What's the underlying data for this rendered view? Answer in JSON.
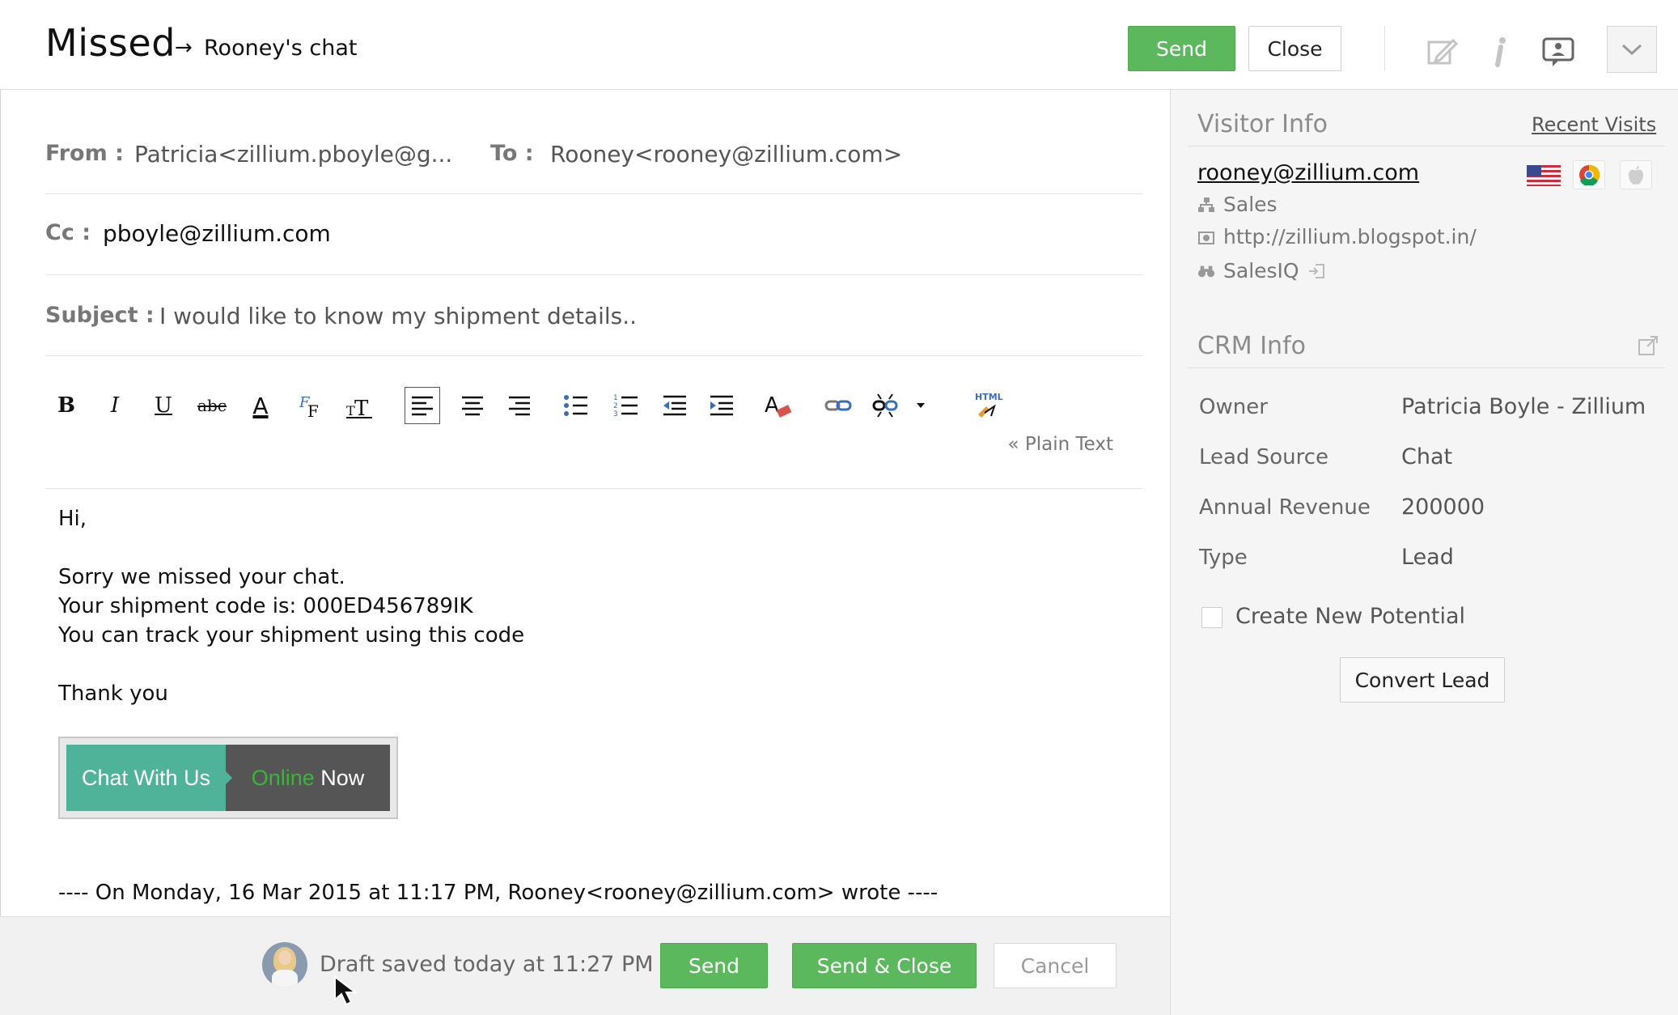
{
  "header": {
    "title": "Missed",
    "arrow": "→",
    "subtitle": "Rooney's chat",
    "send_label": "Send",
    "close_label": "Close"
  },
  "email": {
    "from_label": "From :",
    "from_value": "Patricia<zillium.pboyle@g...",
    "to_label": "To :",
    "to_value": "Rooney<rooney@zillium.com>",
    "cc_label": "Cc :",
    "cc_value": "pboyle@zillium.com",
    "subject_label": "Subject :",
    "subject_value": "I would like to know my shipment details..",
    "plain_text_link": "« Plain Text",
    "body_lines": [
      "Hi,",
      "Sorry we missed your chat.",
      "Your shipment code is: 000ED456789IK",
      "You can track your shipment using this code",
      "Thank you"
    ],
    "banner": {
      "left": "Chat With Us",
      "online": "Online",
      "now": " Now"
    },
    "quote_line": "---- On Monday, 16 Mar 2015 at 11:17 PM, Rooney<rooney@zillium.com> wrote ----"
  },
  "toolbar": {
    "bold": "B",
    "italic": "I",
    "underline": "U",
    "strike": "abc",
    "font_color": "A",
    "html": "HTML"
  },
  "footer": {
    "draft_status": "Draft saved today at 11:27 PM",
    "send_label": "Send",
    "send_close_label": "Send & Close",
    "cancel_label": "Cancel"
  },
  "visitor_info": {
    "title": "Visitor Info",
    "recent_visits": "Recent Visits",
    "email": "rooney@zillium.com",
    "department": "Sales",
    "website": "http://zillium.blogspot.in/",
    "source": "SalesIQ"
  },
  "crm_info": {
    "title": "CRM Info",
    "rows": [
      {
        "label": "Owner",
        "value": "Patricia Boyle - Zillium"
      },
      {
        "label": "Lead Source",
        "value": "Chat"
      },
      {
        "label": "Annual Revenue",
        "value": "200000"
      },
      {
        "label": "Type",
        "value": "Lead"
      }
    ],
    "create_potential_label": "Create New Potential",
    "convert_lead_label": "Convert Lead"
  },
  "colors": {
    "green": "#5cb85c",
    "banner_teal": "#4fb39a",
    "banner_dark": "#555555"
  }
}
